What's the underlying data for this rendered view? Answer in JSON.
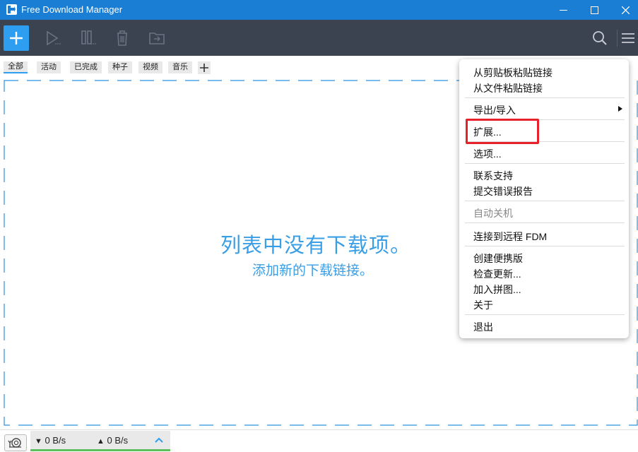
{
  "window": {
    "title": "Free Download Manager",
    "accent_color": "#1a7fd4",
    "controls": [
      "minimize-icon",
      "maximize-icon",
      "close-icon"
    ]
  },
  "toolbar": {
    "buttons": [
      "add-icon",
      "play-icon",
      "pause-icon",
      "delete-icon",
      "move-folder-icon"
    ],
    "right_buttons": [
      "search-icon",
      "hamburger-menu-icon"
    ]
  },
  "filters": {
    "tabs": [
      "全部",
      "活动",
      "已完成",
      "种子",
      "视频",
      "音乐"
    ],
    "active": "全部",
    "add_icon": "plus-icon"
  },
  "empty_state": {
    "title": "列表中没有下载项。",
    "subtitle": "添加新的下载链接。"
  },
  "status": {
    "download_speed": "0 B/s",
    "upload_speed": "0 B/s",
    "snail_icon": "snail-icon"
  },
  "menu": {
    "items": [
      "从剪贴板粘贴链接",
      "从文件粘贴链接",
      "导出/导入",
      "扩展...",
      "选项...",
      "联系支持",
      "提交错误报告",
      "自动关机",
      "连接到远程 FDM",
      "创建便携版",
      "检查更新...",
      "加入拼图...",
      "关于",
      "退出"
    ],
    "disabled_item": "自动关机",
    "highlighted_item": "扩展..."
  }
}
